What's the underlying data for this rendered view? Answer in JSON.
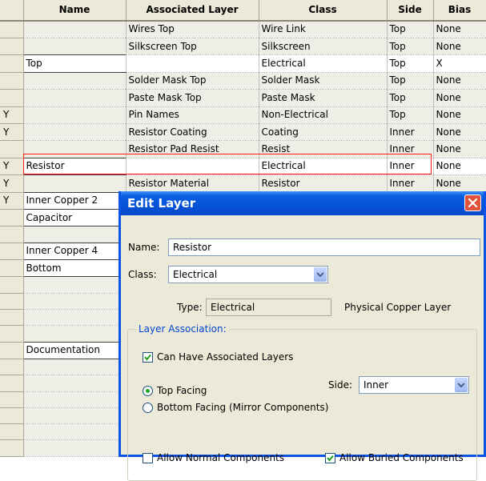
{
  "table": {
    "columns": [
      "",
      "Name",
      "Associated Layer",
      "Class",
      "Side",
      "Bias"
    ],
    "rows": [
      {
        "sel": "",
        "name": "",
        "assoc": "Wires Top",
        "cls": "Wire Link",
        "side": "Top",
        "bias": "None"
      },
      {
        "sel": "",
        "name": "",
        "assoc": "Silkscreen Top",
        "cls": "Silkscreen",
        "side": "Top",
        "bias": "None"
      },
      {
        "sel": "",
        "name": "Top",
        "assoc": "",
        "cls": "Electrical",
        "side": "Top",
        "bias": "X"
      },
      {
        "sel": "",
        "name": "",
        "assoc": "Solder Mask Top",
        "cls": "Solder Mask",
        "side": "Top",
        "bias": "None"
      },
      {
        "sel": "",
        "name": "",
        "assoc": "Paste Mask Top",
        "cls": "Paste Mask",
        "side": "Top",
        "bias": "None"
      },
      {
        "sel": "Y",
        "name": "",
        "assoc": "Pin Names",
        "cls": "Non-Electrical",
        "side": "Top",
        "bias": "None"
      },
      {
        "sel": "Y",
        "name": "",
        "assoc": "Resistor Coating",
        "cls": "Coating",
        "side": "Inner",
        "bias": "None"
      },
      {
        "sel": "",
        "name": "",
        "assoc": "Resistor Pad Resist",
        "cls": "Resist",
        "side": "Inner",
        "bias": "None"
      },
      {
        "sel": "Y",
        "name": "Resistor",
        "assoc": "",
        "cls": "Electrical",
        "side": "Inner",
        "bias": "None"
      },
      {
        "sel": "Y",
        "name": "",
        "assoc": "Resistor Material",
        "cls": "Resistor",
        "side": "Inner",
        "bias": "None"
      },
      {
        "sel": "Y",
        "name": "Inner Copper 2",
        "assoc": "",
        "cls": "",
        "side": "",
        "bias": ""
      },
      {
        "sel": "",
        "name": "Capacitor",
        "assoc": "",
        "cls": "",
        "side": "",
        "bias": ""
      },
      {
        "sel": "",
        "name": "",
        "assoc": "",
        "cls": "",
        "side": "",
        "bias": ""
      },
      {
        "sel": "",
        "name": "Inner Copper 4",
        "assoc": "",
        "cls": "",
        "side": "",
        "bias": ""
      },
      {
        "sel": "",
        "name": "Bottom",
        "assoc": "",
        "cls": "",
        "side": "",
        "bias": ""
      },
      {
        "sel": "",
        "name": "",
        "assoc": "",
        "cls": "",
        "side": "",
        "bias": ""
      },
      {
        "sel": "",
        "name": "",
        "assoc": "",
        "cls": "",
        "side": "",
        "bias": ""
      },
      {
        "sel": "",
        "name": "",
        "assoc": "",
        "cls": "",
        "side": "",
        "bias": ""
      },
      {
        "sel": "",
        "name": "",
        "assoc": "",
        "cls": "",
        "side": "",
        "bias": ""
      },
      {
        "sel": "",
        "name": "Documentation",
        "assoc": "",
        "cls": "",
        "side": "",
        "bias": ""
      },
      {
        "sel": "",
        "name": "",
        "assoc": "",
        "cls": "",
        "side": "",
        "bias": ""
      },
      {
        "sel": "",
        "name": "",
        "assoc": "",
        "cls": "",
        "side": "",
        "bias": ""
      },
      {
        "sel": "",
        "name": "",
        "assoc": "",
        "cls": "",
        "side": "",
        "bias": ""
      },
      {
        "sel": "",
        "name": "",
        "assoc": "",
        "cls": "",
        "side": "",
        "bias": ""
      },
      {
        "sel": "",
        "name": "",
        "assoc": "",
        "cls": "",
        "side": "",
        "bias": ""
      },
      {
        "sel": "",
        "name": "",
        "assoc": "",
        "cls": "",
        "side": "",
        "bias": ""
      }
    ]
  },
  "dialog": {
    "title": "Edit Layer",
    "name_label": "Name:",
    "name_value": "Resistor",
    "class_label": "Class:",
    "class_value": "Electrical",
    "type_label": "Type:",
    "type_value": "Electrical",
    "type_desc": "Physical Copper Layer",
    "group_title": "Layer Association:",
    "can_have_assoc": "Can Have Associated Layers",
    "top_facing": "Top Facing",
    "bottom_facing": "Bottom Facing (Mirror Components)",
    "side_label": "Side:",
    "side_value": "Inner",
    "allow_normal": "Allow Normal Components",
    "allow_buried": "Allow Buried Components"
  },
  "state": {
    "can_have_assoc_checked": true,
    "top_facing_selected": true,
    "allow_normal_checked": false,
    "allow_buried_checked": true
  },
  "colors": {
    "title_bar": "#0a5ee0",
    "highlight_border": "#ff1a1a",
    "group_title": "#0046d5"
  }
}
